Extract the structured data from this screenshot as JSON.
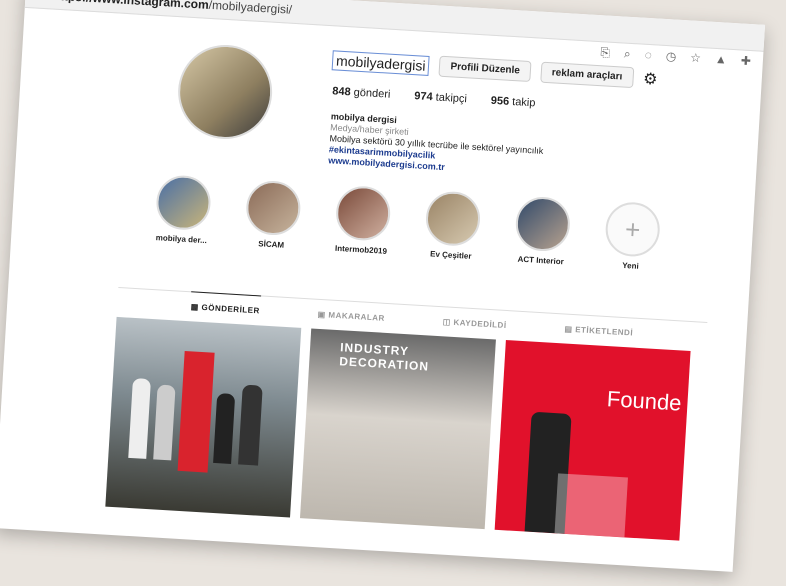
{
  "browser": {
    "url_host": "https://www.instagram.com",
    "url_path": "/mobilyadergisi/"
  },
  "profile": {
    "username": "mobilyadergisi",
    "edit_button": "Profili Düzenle",
    "ads_button": "reklam araçları",
    "stats": {
      "posts": "848",
      "posts_label": "gönderi",
      "followers": "974",
      "followers_label": "takipçi",
      "following": "956",
      "following_label": "takip"
    },
    "bio": {
      "name": "mobilya dergisi",
      "category": "Medya/haber şirketi",
      "description": "Mobilya sektörü 30 yıllık tecrübe ile sektörel yayıncılık",
      "hashtag": "#ekintasarimmobilyacilik",
      "website": "www.mobilyadergisi.com.tr"
    }
  },
  "highlights": [
    {
      "label": "mobilya der..."
    },
    {
      "label": "SİCAM"
    },
    {
      "label": "Intermob2019"
    },
    {
      "label": "Ev Çeşitler"
    },
    {
      "label": "ACT Interior"
    },
    {
      "label": "Yeni"
    }
  ],
  "tabs": [
    "GÖNDERİLER",
    "MAKARALAR",
    "KAYDEDİLDİ",
    "ETİKETLENDİ"
  ],
  "posts": [
    {
      "title": ""
    },
    {
      "title": "INDUSTRY DECORATION"
    },
    {
      "title": "Founde"
    }
  ]
}
